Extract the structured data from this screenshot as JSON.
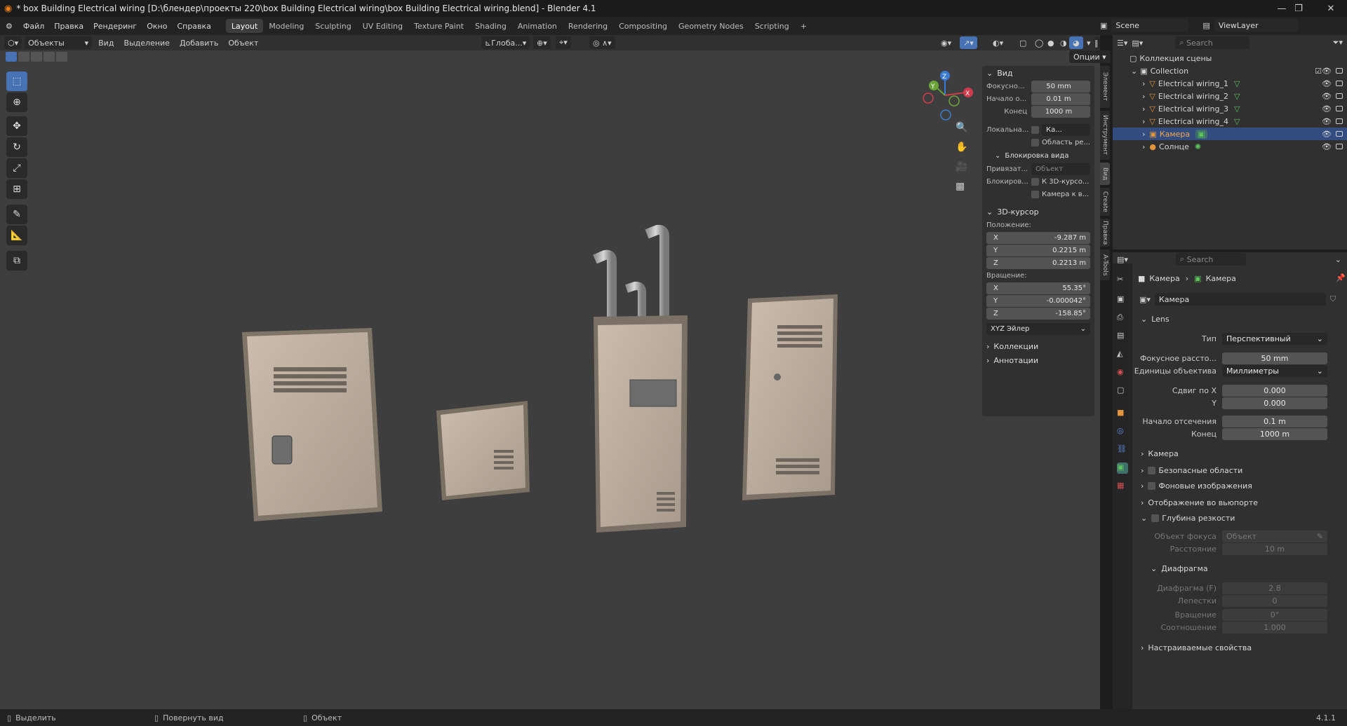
{
  "titlebar": {
    "title": "* box Building Electrical wiring [D:\\блендер\\проекты 220\\box Building Electrical wiring\\box Building Electrical wiring.blend] - Blender 4.1"
  },
  "menu": {
    "items": [
      "Файл",
      "Правка",
      "Рендеринг",
      "Окно",
      "Справка"
    ]
  },
  "workspaces": [
    "Layout",
    "Modeling",
    "Sculpting",
    "UV Editing",
    "Texture Paint",
    "Shading",
    "Animation",
    "Rendering",
    "Compositing",
    "Geometry Nodes",
    "Scripting",
    "+"
  ],
  "scene": {
    "name": "Scene",
    "viewlayer": "ViewLayer"
  },
  "vpheader": {
    "mode": "Объекты",
    "view": "Вид",
    "select": "Выделение",
    "add": "Добавить",
    "object": "Объект",
    "transform": "Глоба...",
    "options": "Опции"
  },
  "npanel": {
    "view_header": "Вид",
    "focal_label": "Фокусно...",
    "focal": "50 mm",
    "clip_start_label": "Начало о...",
    "clip_start": "0.01 m",
    "clip_end_label": "Конец",
    "clip_end": "1000 m",
    "local_label": "Локальна...",
    "local_val": "Ка...",
    "region_label": "Область ре...",
    "lock_header": "Блокировка вида",
    "lock_to_label": "Привязат...",
    "lock_to_val": "Объект",
    "lock_label": "Блокиров...",
    "lock_cursor": "К 3D-курсо...",
    "lock_camera": "Камера к в...",
    "cursor_header": "3D-курсор",
    "location_label": "Положение:",
    "loc_x": "-9.287 m",
    "loc_y": "0.2215 m",
    "loc_z": "0.2213 m",
    "rotation_label": "Вращение:",
    "rot_x": "55.35°",
    "rot_y": "-0.000042°",
    "rot_z": "-158.85°",
    "rot_mode": "XYZ Эйлер",
    "collections": "Коллекции",
    "annotations": "Аннотации",
    "axis_x": "X",
    "axis_y": "Y",
    "axis_z": "Z"
  },
  "ntabs": [
    "Элемент",
    "Инструмент",
    "Вид",
    "Create",
    "Правка",
    "A-Tools"
  ],
  "outliner": {
    "search": "Search",
    "root": "Коллекция сцены",
    "collection": "Collection",
    "items": [
      "Electrical wiring_1",
      "Electrical wiring_2",
      "Electrical wiring_3",
      "Electrical wiring_4",
      "Камера",
      "Солнце"
    ]
  },
  "props": {
    "search": "Search",
    "crumb1": "Камера",
    "crumb2": "Камера",
    "data_name": "Камера",
    "lens_header": "Lens",
    "type_label": "Тип",
    "type_val": "Перспективный",
    "focal_label": "Фокусное рассто...",
    "focal_val": "50 mm",
    "units_label": "Единицы объектива",
    "units_val": "Миллиметры",
    "shiftx_label": "Сдвиг по X",
    "shiftx_val": "0.000",
    "shifty_label": "Y",
    "shifty_val": "0.000",
    "clipstart_label": "Начало отсечения",
    "clipstart_val": "0.1 m",
    "clipend_label": "Конец",
    "clipend_val": "1000 m",
    "camera": "Камера",
    "safe": "Безопасные области",
    "bg": "Фоновые изображения",
    "vpdisplay": "Отображение во вьюпорте",
    "dof": "Глубина резкости",
    "focus_obj_label": "Объект фокуса",
    "focus_obj_val": "Объект",
    "distance_label": "Расстояние",
    "distance_val": "10 m",
    "aperture_header": "Диафрагма",
    "fstop_label": "Диафрагма (F)",
    "fstop_val": "2.8",
    "blades_label": "Лепестки",
    "blades_val": "0",
    "rotation_label": "Вращение",
    "rotation_val": "0°",
    "ratio_label": "Соотношение",
    "ratio_val": "1.000",
    "custom": "Настраиваемые свойства"
  },
  "statusbar": {
    "select": "Выделить",
    "rotate": "Повернуть вид",
    "object": "Объект",
    "version": "4.1.1"
  }
}
